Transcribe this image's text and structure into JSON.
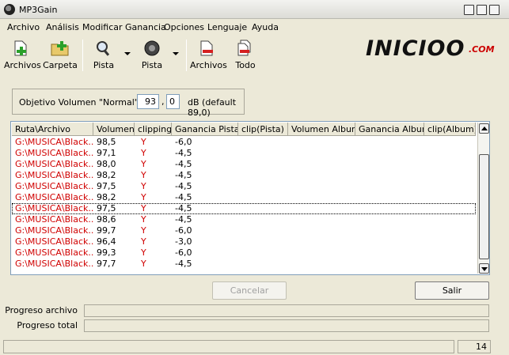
{
  "window": {
    "title": "MP3Gain"
  },
  "menu": [
    "Archivo",
    "Análisis",
    "Modificar Ganancia",
    "Opciones",
    "Lenguaje",
    "Ayuda"
  ],
  "toolbar": {
    "add_files": "Archivos",
    "add_folder": "Carpeta",
    "track_analysis": "Pista",
    "track_gain": "Pista",
    "clear_files": "Archivos",
    "clear_all": "Todo"
  },
  "logo": {
    "main": "INICIOO",
    "suffix": ".COM",
    "color_main": "#111111",
    "color_suffix": "#cc0000"
  },
  "target": {
    "label": "Objetivo Volumen \"Normal\":",
    "integer": "93",
    "decimal": "0",
    "unit_text": "dB  (default 89,0)"
  },
  "table": {
    "columns": [
      "Ruta\\Archivo",
      "Volumen",
      "clipping",
      "Ganancia Pista",
      "clip(Pista)",
      "Volumen Album",
      "Ganancia Album",
      "clip(Album)"
    ],
    "rows": [
      {
        "path": "G:\\MUSICA\\Black...",
        "volume": "98,5",
        "clipping": "Y",
        "track_gain": "-6,0"
      },
      {
        "path": "G:\\MUSICA\\Black...",
        "volume": "97,1",
        "clipping": "Y",
        "track_gain": "-4,5"
      },
      {
        "path": "G:\\MUSICA\\Black...",
        "volume": "98,0",
        "clipping": "Y",
        "track_gain": "-4,5"
      },
      {
        "path": "G:\\MUSICA\\Black...",
        "volume": "98,2",
        "clipping": "Y",
        "track_gain": "-4,5"
      },
      {
        "path": "G:\\MUSICA\\Black...",
        "volume": "97,5",
        "clipping": "Y",
        "track_gain": "-4,5"
      },
      {
        "path": "G:\\MUSICA\\Black...",
        "volume": "98,2",
        "clipping": "Y",
        "track_gain": "-4,5"
      },
      {
        "path": "G:\\MUSICA\\Black...",
        "volume": "97,5",
        "clipping": "Y",
        "track_gain": "-4,5"
      },
      {
        "path": "G:\\MUSICA\\Black...",
        "volume": "98,6",
        "clipping": "Y",
        "track_gain": "-4,5"
      },
      {
        "path": "G:\\MUSICA\\Black...",
        "volume": "99,7",
        "clipping": "Y",
        "track_gain": "-6,0"
      },
      {
        "path": "G:\\MUSICA\\Black...",
        "volume": "96,4",
        "clipping": "Y",
        "track_gain": "-3,0"
      },
      {
        "path": "G:\\MUSICA\\Black...",
        "volume": "99,3",
        "clipping": "Y",
        "track_gain": "-6,0"
      },
      {
        "path": "G:\\MUSICA\\Black...",
        "volume": "97,7",
        "clipping": "Y",
        "track_gain": "-4,5"
      }
    ],
    "selected_row": 6
  },
  "buttons": {
    "cancel": "Cancelar",
    "exit": "Salir"
  },
  "progress": {
    "file_label": "Progreso archivo",
    "total_label": "Progreso total",
    "file_value": 0,
    "total_value": 0
  },
  "status": {
    "count": "14"
  },
  "colors": {
    "path_text": "#d00000",
    "clip_text": "#d00000",
    "window_bg": "#ece9d8"
  }
}
